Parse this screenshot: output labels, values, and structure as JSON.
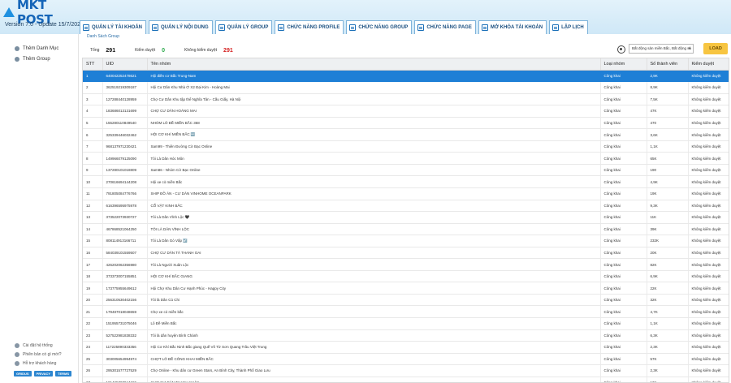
{
  "app": {
    "logo_text": "MKT POST",
    "version": "Version  7.0  -  Update  15/7/2023"
  },
  "tabs": [
    {
      "label": "QUẢN LÝ TÀI KHOẢN"
    },
    {
      "label": "QUẢN LÝ NỘI DUNG"
    },
    {
      "label": "QUẢN LÝ GROUP"
    },
    {
      "label": "CHỨC NĂNG PROFILE"
    },
    {
      "label": "CHỨC NĂNG GROUP"
    },
    {
      "label": "CHỨC NĂNG PAGE"
    },
    {
      "label": "MỞ KHÓA TÀI KHOẢN"
    },
    {
      "label": "LẬP LỊCH"
    }
  ],
  "sidebar": {
    "items": [
      {
        "label": "Thêm Danh Mục"
      },
      {
        "label": "Thêm Group"
      }
    ],
    "footer": [
      {
        "label": "Cài đặt hệ thống"
      },
      {
        "label": "Phiên bản có gì mới?"
      },
      {
        "label": "Hỗ trợ khách hàng"
      }
    ],
    "badges": [
      "GRIDUS",
      "PRIVACY",
      "TERMS"
    ]
  },
  "main": {
    "group_title": "Danh Sách Group",
    "stats": {
      "total_label": "Tổng",
      "total_value": "291",
      "approved_label": "Kiểm duyệt",
      "approved_value": "0",
      "unapproved_label": "Không kiểm duyệt",
      "unapproved_value": "291"
    },
    "filter_value": "Bất động sản miền Bắc, Bất động sả",
    "load_label": "LOAD"
  },
  "table": {
    "columns": [
      "STT",
      "UID",
      "Tên nhóm",
      "Loại nhóm",
      "Số thành viên",
      "Kiểm duyệt"
    ],
    "rows": [
      [
        "1",
        "640042252478621",
        "Hội điền cơ Bắc Trung-Nam",
        "Công khai",
        "2,9K",
        "Không kiểm duyệt"
      ],
      [
        "2",
        "362519219309187",
        "Hội Cư Dân Khu Nhà Ở X2 Đại Kim - Hoàng Mai",
        "Công khai",
        "8,9K",
        "Không kiểm duyệt"
      ],
      [
        "3",
        "127288440128959",
        "Chợ Cư Dân Khu tập thể Nghĩa Tân - Cầu Giấy, Hà Nội",
        "Công khai",
        "7,5K",
        "Không kiểm duyệt"
      ],
      [
        "4",
        "183686013131699",
        "CHỢ CƯ DÂN HOÀNG MAI",
        "Công khai",
        "47K",
        "Không kiểm duyệt"
      ],
      [
        "5",
        "155280110849540",
        "NHÓM LÔ ĐỀ MIỀN BẮC 368",
        "Công khai",
        "470",
        "Không kiểm duyệt"
      ],
      [
        "6",
        "325339446032462",
        "HỘI CƠ KHÍ MIỀN BẮC 🆓",
        "Công khai",
        "3,6K",
        "Không kiểm duyệt"
      ],
      [
        "7",
        "968137971230421",
        "Sam99 - Thiên Đường Cờ Bạc Online",
        "Công khai",
        "1,1K",
        "Không kiểm duyệt"
      ],
      [
        "8",
        "149966079125090",
        "Tôi Là Dân Hóc Môn",
        "Công khai",
        "65K",
        "Không kiểm duyệt"
      ],
      [
        "9",
        "137280101018809",
        "Sam86 - Nhóm Cờ Bạc Online",
        "Công khai",
        "190",
        "Không kiểm duyệt"
      ],
      [
        "10",
        "270616694144208",
        "Hội xe cỏ miền Bắc",
        "Công khai",
        "4,9K",
        "Không kiểm duyệt"
      ],
      [
        "11",
        "791805084776766",
        "SHIP ĐỒ ĂN - CƯ DÂN VINHOME OCEANPARK",
        "Công khai",
        "19K",
        "Không kiểm duyệt"
      ],
      [
        "12",
        "616396595975978",
        "CỔ VẬT KINH BẮC",
        "Công khai",
        "9,3K",
        "Không kiểm duyệt"
      ],
      [
        "13",
        "373522073930727",
        "Tôi Là Dân Vĩnh Lộc 🖤",
        "Công khai",
        "11K",
        "Không kiểm duyệt"
      ],
      [
        "14",
        "467868521064250",
        "TÔI LÀ DÂN VĨNH LỘC",
        "Công khai",
        "39K",
        "Không kiểm duyệt"
      ],
      [
        "15",
        "808114913166711",
        "Tôi Là Dân Gò Vấp ☑️",
        "Công khai",
        "232K",
        "Không kiểm duyệt"
      ],
      [
        "16",
        "584039101559507",
        "CHỢ CƯ DÂN TÂ THANH OAI",
        "Công khai",
        "20K",
        "Không kiểm duyệt"
      ],
      [
        "17",
        "426202062356980",
        "Tôi Là Người Xuân Lộc",
        "Công khai",
        "82K",
        "Không kiểm duyệt"
      ],
      [
        "18",
        "373373007155851",
        "HỘI CƠ KHÍ BẮC GIANG",
        "Công khai",
        "6,9K",
        "Không kiểm duyệt"
      ],
      [
        "19",
        "173775955649612",
        "Hội Chợ Khu Dân Cư Hạnh Phúc - Happy City",
        "Công khai",
        "22K",
        "Không kiểm duyệt"
      ],
      [
        "20",
        "256310530402156",
        "Tôi là Dân Củ Chi",
        "Công khai",
        "32K",
        "Không kiểm duyệt"
      ],
      [
        "21",
        "179487018048659",
        "Chợ xe cỏ miền bắc",
        "Công khai",
        "4,7K",
        "Không kiểm duyệt"
      ],
      [
        "22",
        "151955731075046",
        "Lô Đề Miền Bắc",
        "Công khai",
        "1,1K",
        "Không kiểm duyệt"
      ],
      [
        "23",
        "527522981838332",
        "Tôi là dân huyện Bình Chánh",
        "Công khai",
        "6,3K",
        "Không kiểm duyệt"
      ],
      [
        "24",
        "117225890333356",
        "Hội Cơ Khí Bắc Ninh Bắc giang Quế Võ Từ Sơn Quang Trâu Việt Trung",
        "Công khai",
        "2,3K",
        "Không kiểm duyệt"
      ],
      [
        "25",
        "303005654994974",
        "CHỢT LÔ ĐỀ CÔNG KHAI MIỀN BẮC",
        "Công khai",
        "57K",
        "Không kiểm duyệt"
      ],
      [
        "26",
        "295301577727529",
        "Chợ Online - Khu dân cư Green Stars, An Bình City, Thành Phố Giao Lưu",
        "Công khai",
        "2,3K",
        "Không kiểm duyệt"
      ],
      [
        "27",
        "101425707044226",
        "CHỢ CƯ DÂN THANH XUÂN",
        "Công khai",
        "13K",
        "Không kiểm duyệt"
      ]
    ]
  },
  "colors": {
    "brand": "#1565b8",
    "selected_row": "#1e7fd6",
    "load_button": "#f7c541",
    "approved": "#2aa84a",
    "unapproved": "#d42020"
  }
}
